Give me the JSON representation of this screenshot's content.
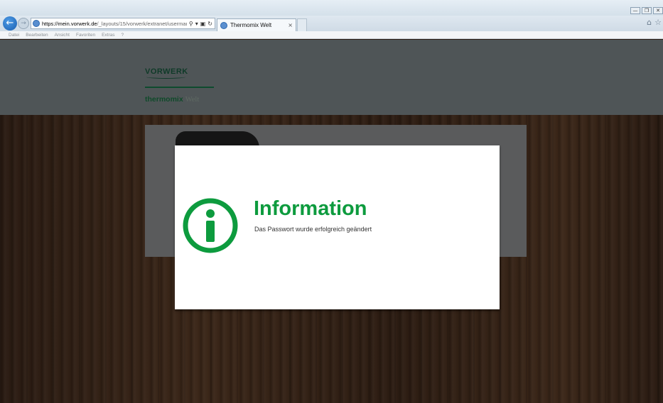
{
  "browser": {
    "url_domain": "https://mein.vorwerk.de",
    "url_path": "/_layouts/15/vorwerk/extranet/usermanagem…",
    "tab_title": "Thermomix Welt",
    "tab_close": "×",
    "menu": [
      "Datei",
      "Bearbeiten",
      "Ansicht",
      "Favoriten",
      "Extras",
      "?"
    ]
  },
  "header": {
    "brand": "VORWERK",
    "product_name": "thermomix",
    "product_suffix": "Welt"
  },
  "dialog": {
    "title": "Information",
    "message": "Das Passwort wurde erfolgreich geändert",
    "icon": "info-icon",
    "accent_color": "#0d9b3e"
  }
}
